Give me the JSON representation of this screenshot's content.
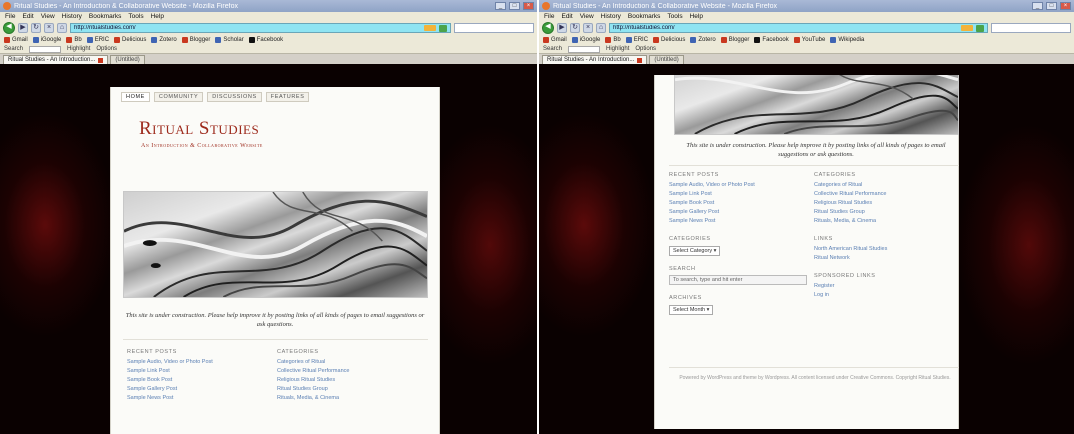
{
  "browser": {
    "title": "Ritual Studies - An Introduction & Collaborative Website - Mozilla Firefox",
    "menu": [
      "File",
      "Edit",
      "View",
      "History",
      "Bookmarks",
      "Tools",
      "Help"
    ],
    "url": "http://ritualstudies.com/",
    "bookmarks": [
      "Gmail",
      "iGoogle",
      "Bb",
      "ERIC",
      "Delicious",
      "Zotero",
      "Blogger",
      "Scholar",
      "Facebook",
      "YouTube",
      "Wikipedia"
    ],
    "toolbar3": [
      "Search",
      "Highlight",
      "Options"
    ],
    "tabs": {
      "active": "Ritual Studies - An Introduction...",
      "inactive": "(Untitled)"
    }
  },
  "site": {
    "nav": [
      "HOME",
      "COMMUNITY",
      "DISCUSSIONS",
      "FEATURES"
    ],
    "title": "Ritual Studies",
    "tagline": "An Introduction & Collaborative Website",
    "caption": "This site is under construction. Please help improve it by posting links of all kinds of pages to email suggestions or ask questions.",
    "recent_posts": {
      "title": "RECENT POSTS",
      "items": [
        "Sample Audio, Video or Photo Post",
        "Sample Link Post",
        "Sample Book Post",
        "Sample Gallery Post",
        "Sample News Post"
      ]
    },
    "categories": {
      "title": "CATEGORIES",
      "items": [
        "Categories of Ritual",
        "Collective Ritual Performance",
        "Religious Ritual Studies",
        "Ritual Studies Group",
        "Rituals, Media, & Cinema"
      ]
    },
    "categories_dropdown": {
      "title": "CATEGORIES",
      "selected": "Select Category"
    },
    "search": {
      "title": "SEARCH",
      "placeholder": "To search, type and hit enter"
    },
    "archives": {
      "title": "ARCHIVES",
      "selected": "Select Month"
    },
    "links": {
      "title": "LINKS",
      "items": [
        "North American Ritual Studies",
        "Ritual Network"
      ]
    },
    "meta": {
      "title": "SPONSORED LINKS",
      "items": [
        "Register",
        "Log in"
      ]
    },
    "footer": "Powered by WordPress and theme by Wordpress. All content licensed under Creative Commons. Copyright Ritual Studies."
  }
}
